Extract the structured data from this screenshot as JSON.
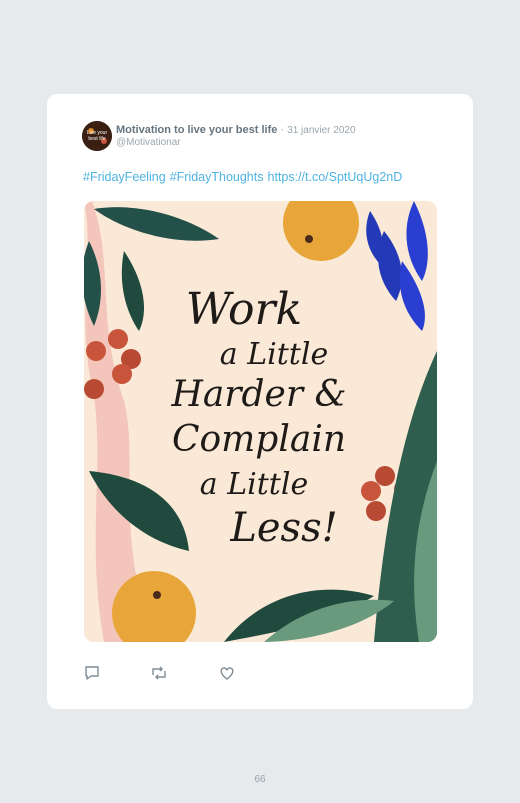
{
  "tweet": {
    "author_name": "Motivation to live your best life",
    "separator": "·",
    "date": "31 janvier 2020",
    "handle": "@Motivationar",
    "avatar_text": "Live your best life",
    "text_parts": [
      "#FridayFeeling",
      "#FridayThoughts",
      "https://t.co/SptUqUg2nD"
    ]
  },
  "image": {
    "quote_lines": [
      "Work",
      "a Little",
      "Harder &",
      "Complain",
      "a Little",
      "Less!"
    ]
  },
  "actions": {
    "reply_icon": "reply-icon",
    "retweet_icon": "retweet-icon",
    "like_icon": "heart-icon"
  },
  "page": {
    "number": "66"
  },
  "colors": {
    "background": "#e6eaed",
    "card": "#ffffff",
    "link": "#4fb3e3",
    "image_bg": "#fbe9d7",
    "orange": "#e8a63a",
    "berry": "#c8543b",
    "leaf_dark": "#1f4a3d",
    "leaf_blue": "#2a3fd1"
  }
}
